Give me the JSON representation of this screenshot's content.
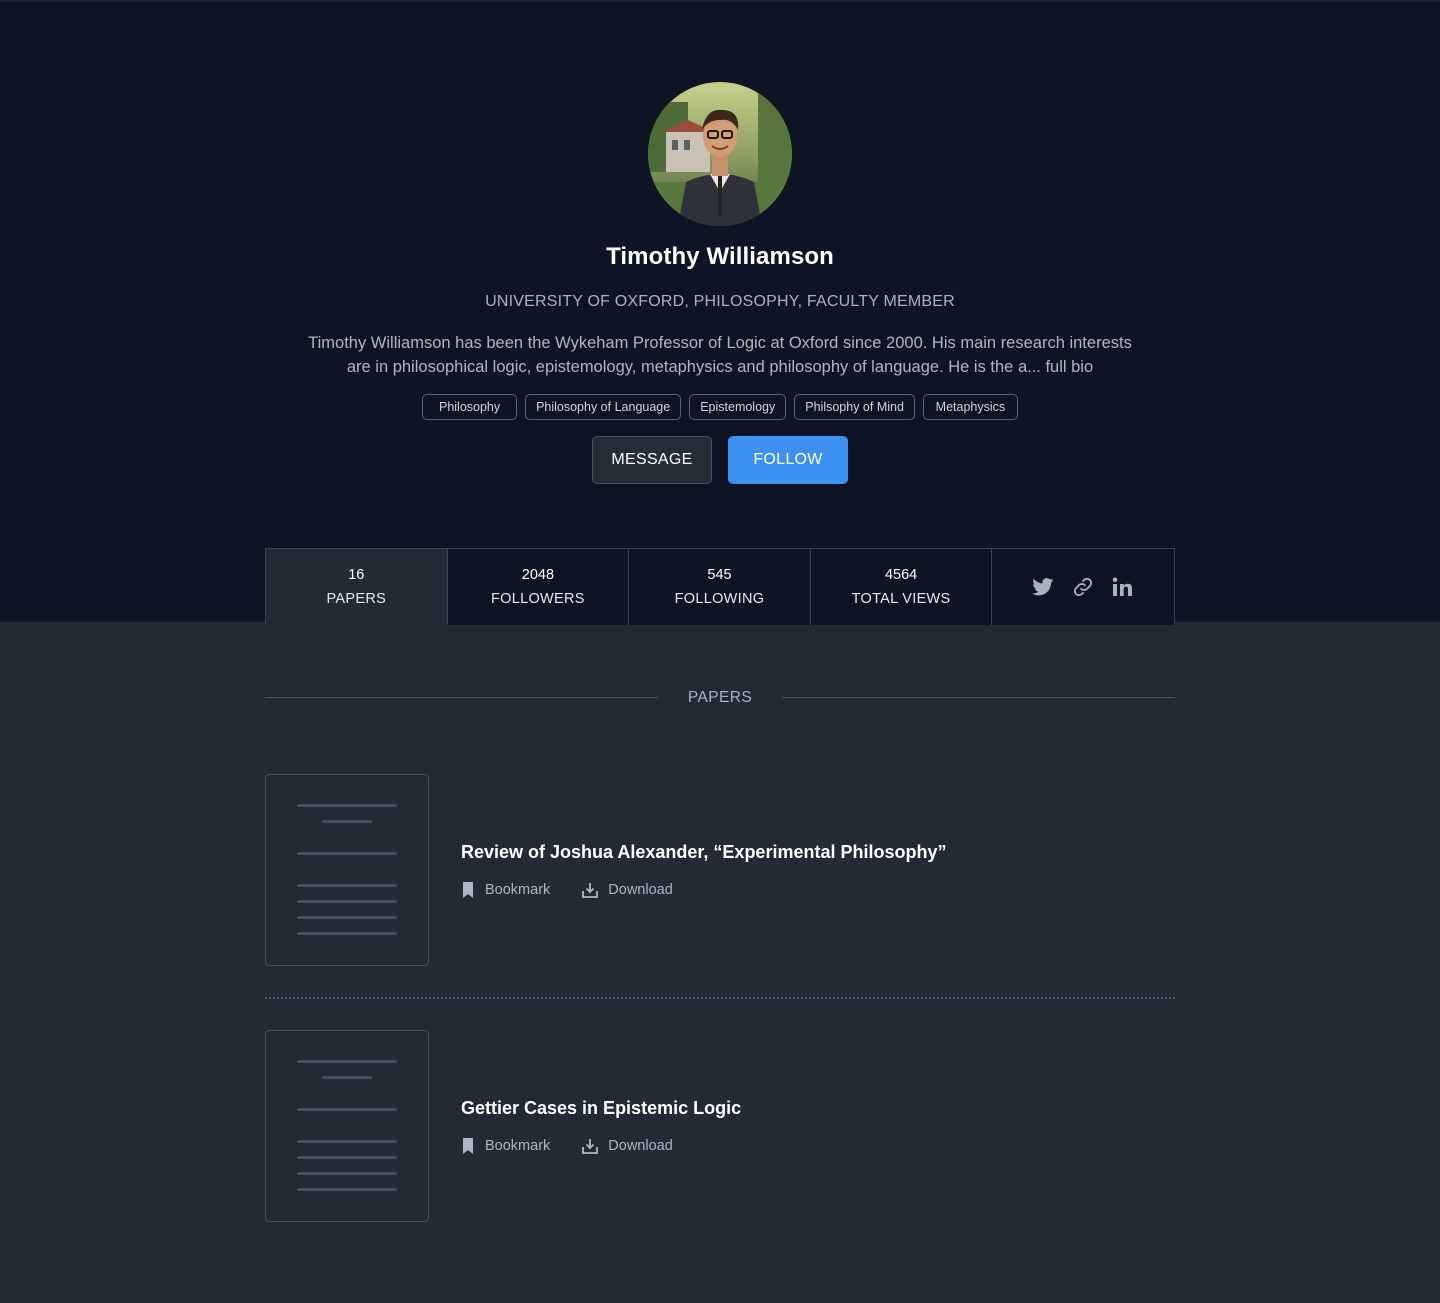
{
  "profile": {
    "name": "Timothy Williamson",
    "affiliation": "UNIVERSITY OF OXFORD, PHILOSOPHY, FACULTY MEMBER",
    "bio_line1": "Timothy Williamson has been the Wykeham Professor of Logic at Oxford since 2000. His main research interests",
    "bio_line2": "are in philosophical logic, epistemology, metaphysics and philosophy of language. He is the a... full bio",
    "tags": [
      "Philosophy",
      "Philosophy of Language",
      "Epistemology",
      "Philsophy of Mind",
      "Metaphysics"
    ]
  },
  "buttons": {
    "message": "MESSAGE",
    "follow": "FOLLOW"
  },
  "stats": [
    {
      "value": "16",
      "label": "PAPERS"
    },
    {
      "value": "2048",
      "label": "FOLLOWERS"
    },
    {
      "value": "545",
      "label": "FOLLOWING"
    },
    {
      "value": "4564",
      "label": "TOTAL VIEWS"
    }
  ],
  "social_icons": [
    "twitter-icon",
    "link-icon",
    "linkedin-icon"
  ],
  "papers_section": {
    "title": "PAPERS",
    "items": [
      {
        "title": "Review of Joshua Alexander, “Experimental Philosophy”",
        "bookmark": "Bookmark",
        "download": "Download"
      },
      {
        "title": "Gettier Cases in Epistemic Logic",
        "bookmark": "Bookmark",
        "download": "Download"
      }
    ]
  },
  "colors": {
    "hero_bg": "#0d1525",
    "page_bg": "#222a33",
    "accent": "#3d8ff0"
  }
}
